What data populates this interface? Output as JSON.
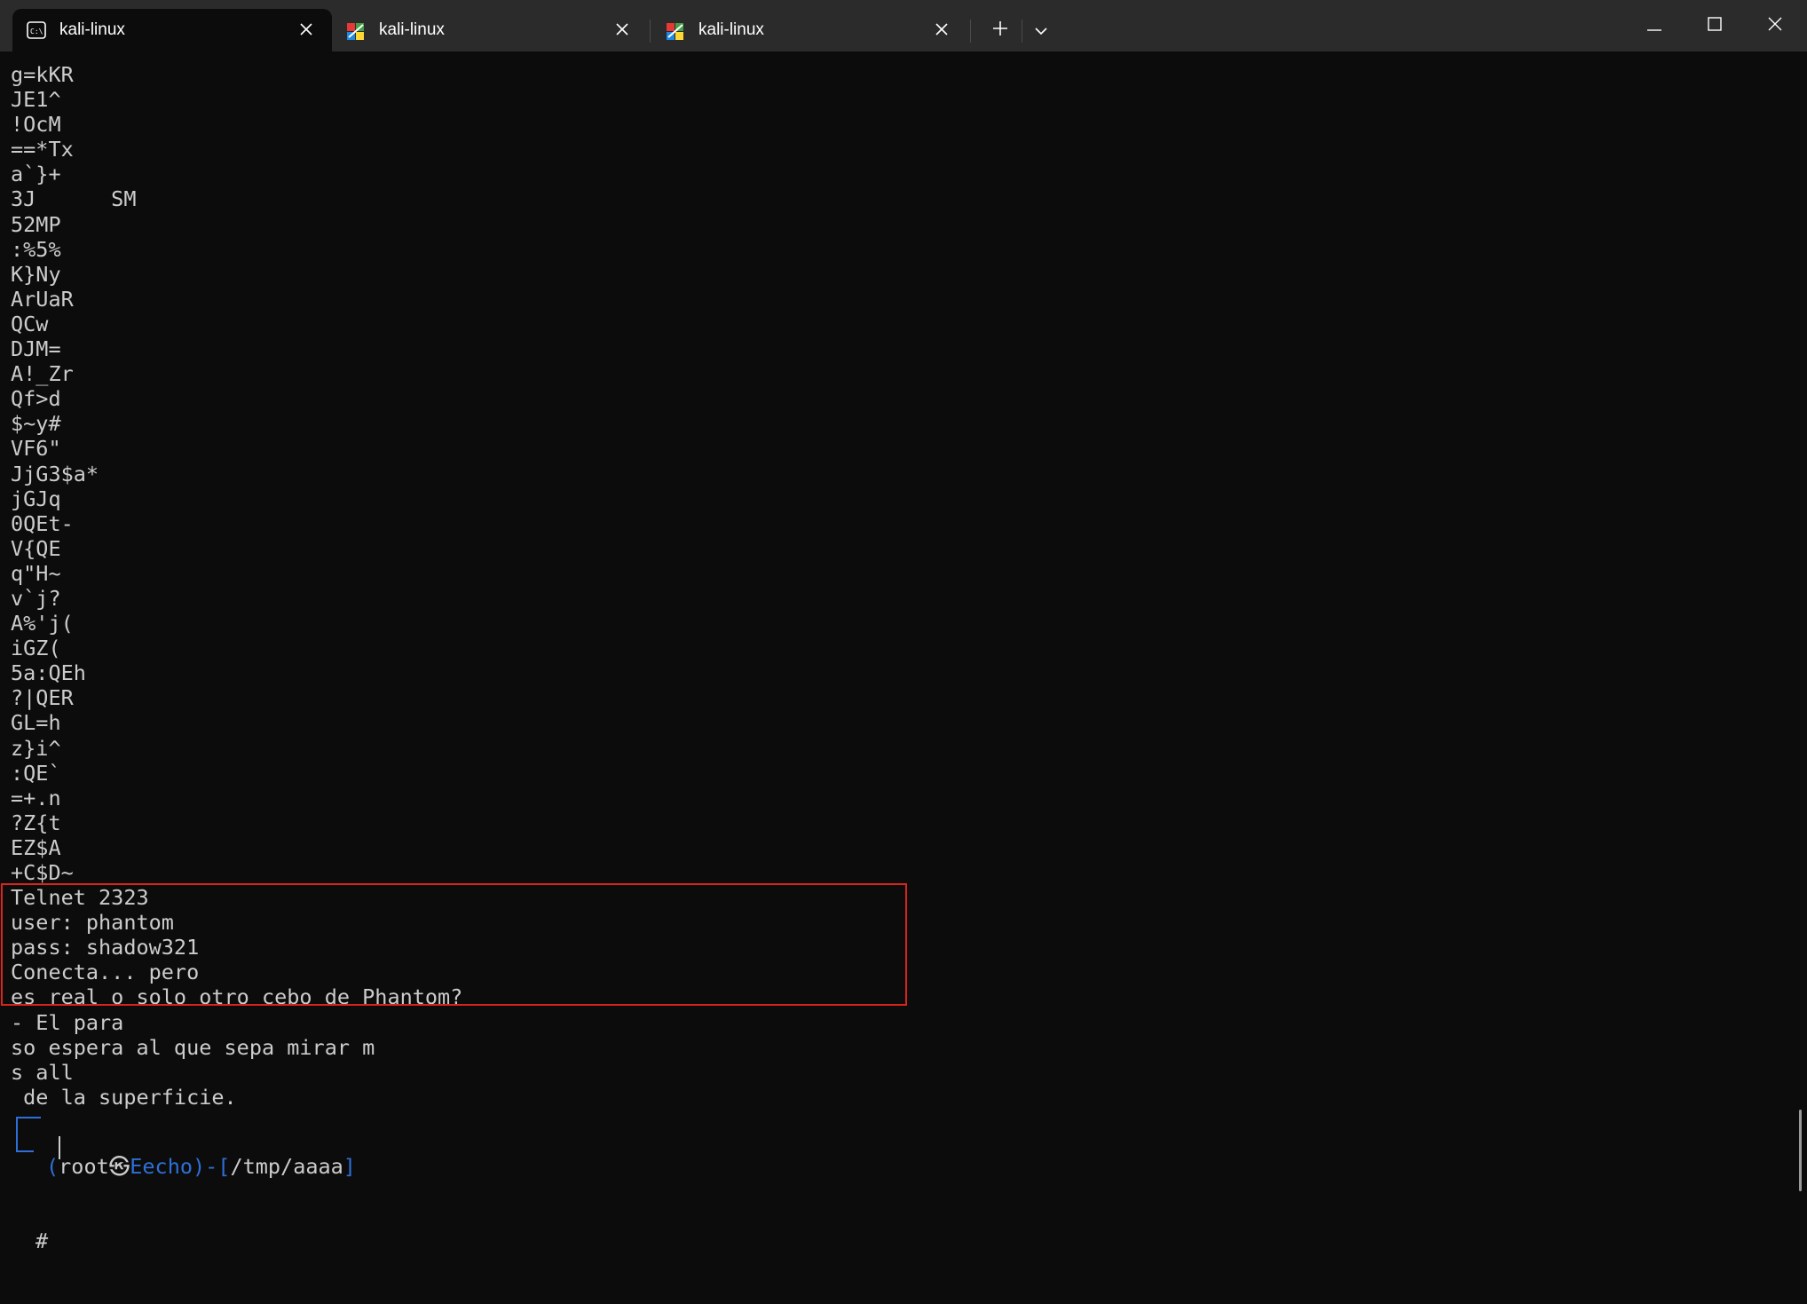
{
  "tabs": [
    {
      "label": "kali-linux",
      "icon": "terminal-icon",
      "active": true
    },
    {
      "label": "kali-linux",
      "icon": "kali-icon",
      "active": false
    },
    {
      "label": "kali-linux",
      "icon": "kali-icon",
      "active": false
    }
  ],
  "toolbar": {
    "new_tab_icon": "plus-icon",
    "dropdown_icon": "chevron-down-icon"
  },
  "window_controls": [
    "minimize-icon",
    "maximize-icon",
    "close-icon"
  ],
  "terminal": {
    "lines": [
      "g=kKR",
      "JE1^",
      "!OcM",
      "==*Tx",
      "a`}+",
      "3J      SM",
      "52MP",
      ":%5%",
      "K}Ny",
      "ArUaR",
      "QCw",
      "DJM=",
      "A!_Zr",
      "Qf>d",
      "$~y#",
      "VF6\"",
      "JjG3$a*",
      "jGJq",
      "0QEt-",
      "V{QE",
      "q\"H~",
      "v`j?",
      "A%'j(",
      "iGZ(",
      "5a:QEh",
      "?|QER",
      "GL=h",
      "z}i^",
      ":QE`",
      "=+.n",
      "?Z{t",
      "EZ$A",
      "+C$D~",
      "Telnet 2323",
      "user: phantom",
      "pass: shadow321",
      "Conecta... pero",
      "es real o solo otro cebo de Phantom?",
      "- El para",
      "so espera al que sepa mirar m",
      "s all",
      " de la superficie."
    ],
    "highlighted_lines": [
      33,
      37
    ],
    "prompt": {
      "open": "(",
      "user": "root",
      "at_symbol": "㉿",
      "host": "Eecho",
      "close": ")-[",
      "path": "/tmp/aaaa",
      "end": "]",
      "symbol": "#"
    }
  },
  "colors": {
    "background": "#0c0c0c",
    "titlebar": "#2b2b2b",
    "text": "#cccccc",
    "prompt_accent": "#2f6fd8",
    "highlight_border": "#d9241c"
  }
}
